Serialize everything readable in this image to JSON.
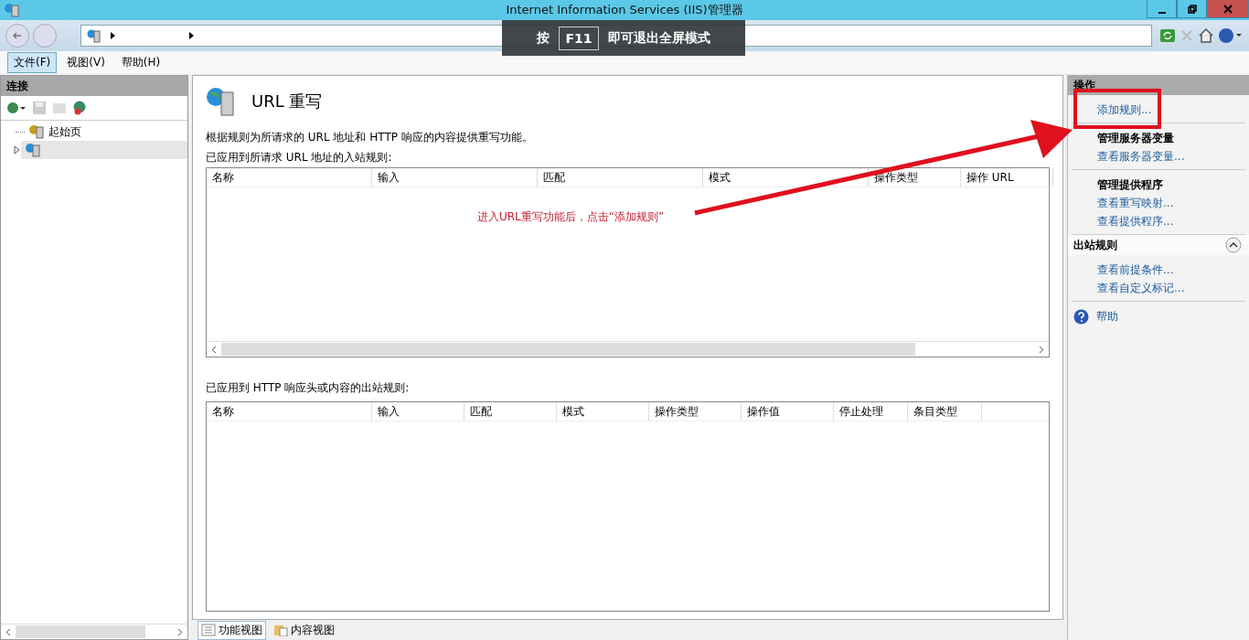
{
  "window": {
    "title": "Internet Information Services (IIS)管理器"
  },
  "fullscreen_hint": {
    "before": "按",
    "key": "F11",
    "after": "即可退出全屏模式"
  },
  "menu": [
    {
      "label": "文件(F)",
      "selected": true
    },
    {
      "label": "视图(V)",
      "selected": false
    },
    {
      "label": "帮助(H)",
      "selected": false
    }
  ],
  "connections": {
    "title": "连接",
    "tree": [
      {
        "kind": "start",
        "label": "起始页",
        "selected": false
      },
      {
        "kind": "server",
        "expanded": false,
        "selected": true
      }
    ]
  },
  "feature": {
    "title": "URL 重写",
    "description": "根据规则为所请求的 URL 地址和 HTTP 响应的内容提供重写功能。",
    "inbound": {
      "label": "已应用到所请求 URL 地址的入站规则:",
      "columns": [
        "名称",
        "输入",
        "匹配",
        "模式",
        "操作类型",
        "操作 URL"
      ]
    },
    "outbound": {
      "label": "已应用到 HTTP 响应头或内容的出站规则:",
      "columns": [
        "名称",
        "输入",
        "匹配",
        "模式",
        "操作类型",
        "操作值",
        "停止处理",
        "条目类型"
      ]
    }
  },
  "view_tabs": [
    {
      "label": "功能视图",
      "kind": "features",
      "selected": true
    },
    {
      "label": "内容视图",
      "kind": "content",
      "selected": false
    }
  ],
  "actions": {
    "title": "操作",
    "groups": [
      {
        "items": [
          {
            "kind": "link",
            "label": "添加规则..."
          }
        ]
      },
      {
        "items": [
          {
            "kind": "heading",
            "label": "管理服务器变量"
          },
          {
            "kind": "link",
            "label": "查看服务器变量..."
          }
        ]
      },
      {
        "items": [
          {
            "kind": "heading",
            "label": "管理提供程序"
          },
          {
            "kind": "link",
            "label": "查看重写映射..."
          },
          {
            "kind": "link",
            "label": "查看提供程序..."
          }
        ]
      }
    ],
    "section": {
      "label": "出站规则",
      "expanded": true,
      "items": [
        {
          "label": "查看前提条件..."
        },
        {
          "label": "查看自定义标记..."
        }
      ]
    },
    "help": {
      "label": "帮助"
    }
  },
  "annotation": {
    "text": "进入URL重写功能后，点击“添加规则”"
  }
}
